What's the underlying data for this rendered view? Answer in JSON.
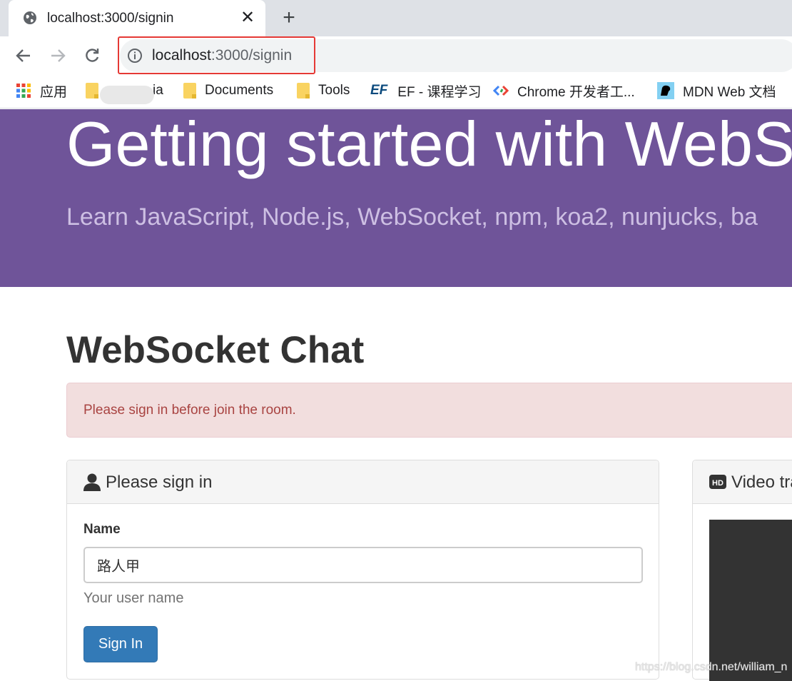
{
  "browser": {
    "tab": {
      "title": "localhost:3000/signin",
      "close_label": "✕",
      "icon": "globe-icon"
    },
    "new_tab_label": "+",
    "nav": {
      "back_icon": "back-arrow-icon",
      "forward_icon": "forward-arrow-icon",
      "reload_icon": "reload-icon"
    },
    "url": {
      "host": "localhost",
      "path": ":3000/signin",
      "icon": "info-icon"
    },
    "bookmarks": [
      {
        "label": "应用",
        "icon": "apps-grid-icon"
      },
      {
        "label": "ia",
        "icon": "folder-icon"
      },
      {
        "label": "Documents",
        "icon": "folder-icon"
      },
      {
        "label": "Tools",
        "icon": "folder-icon"
      },
      {
        "label": "EF - 课程学习",
        "icon": "ef-logo-icon"
      },
      {
        "label": "Chrome 开发者工...",
        "icon": "chrome-dev-icon"
      },
      {
        "label": "MDN Web 文档",
        "icon": "mdn-icon"
      }
    ],
    "colors": {
      "highlight": "#e53935"
    }
  },
  "page": {
    "jumbotron": {
      "title": "Getting started with WebS",
      "subtitle": "Learn JavaScript, Node.js, WebSocket, npm, koa2, nunjucks, ba",
      "color": "#6f5499"
    },
    "heading": "WebSocket Chat",
    "alert": {
      "text": "Please sign in before join the room.",
      "color": "#a94442"
    },
    "signin_panel": {
      "icon": "user-icon",
      "title": "Please sign in",
      "name_label": "Name",
      "name_value": "路人甲",
      "help": "Your user name",
      "button": "Sign In",
      "button_color": "#337ab7"
    },
    "video_panel": {
      "icon": "hd-icon",
      "title": "Video tra"
    },
    "watermark": "https://blog.csdn.net/william_n"
  }
}
